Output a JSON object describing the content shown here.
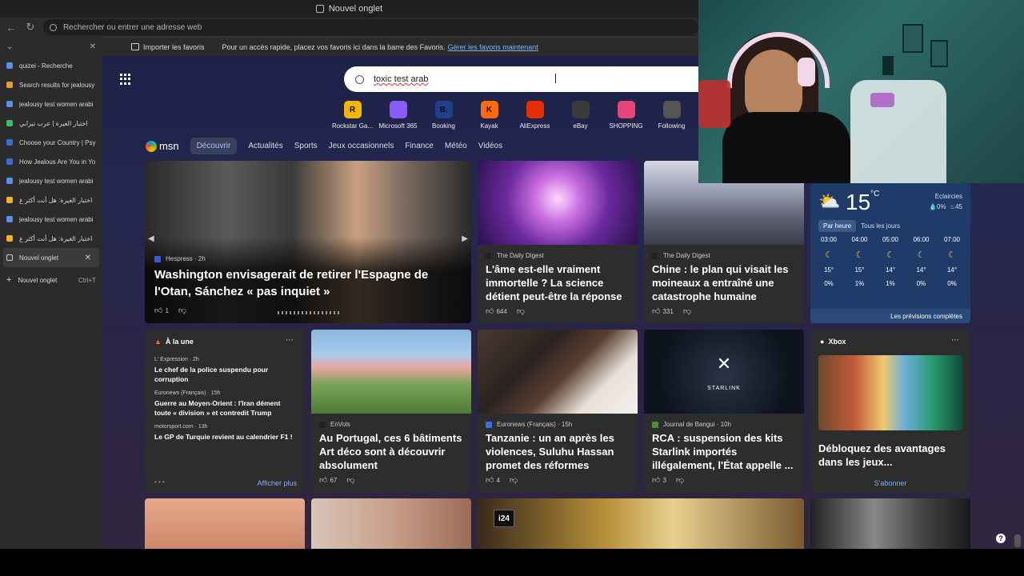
{
  "window": {
    "tab_title": "Nouvel onglet"
  },
  "address_bar": {
    "placeholder": "Rechercher ou entrer une adresse web"
  },
  "favorites_bar": {
    "import_label": "Importer les favoris",
    "message": "Pour un accès rapide, placez vos favoris ici dans la barre des Favoris.",
    "manage_link": "Gérer les favoris maintenant"
  },
  "sidebar": {
    "tabs": [
      {
        "label": "quizei - Recherche",
        "color": "#5a8dee"
      },
      {
        "label": "Search results for jealousy",
        "color": "#e0a030"
      },
      {
        "label": "jealousy test women arabi",
        "color": "#5a8dee"
      },
      {
        "label": "اختبار الغيرة | عرب تيرابي",
        "color": "#36c06a",
        "rtl": true
      },
      {
        "label": "Choose your Country | Psy",
        "color": "#3b6fd6"
      },
      {
        "label": "How Jealous Are You in Yo",
        "color": "#3b6fd6"
      },
      {
        "label": "jealousy test women arabi",
        "color": "#5a8dee"
      },
      {
        "label": "اختبار الغيرة: هل أنت أكثر غ",
        "color": "#f0b429",
        "rtl": true
      },
      {
        "label": "jealousy test women arabi",
        "color": "#5a8dee"
      },
      {
        "label": "اختبار الغيرة: هل أنت أكثر غ",
        "color": "#f0b429",
        "rtl": true
      }
    ],
    "active_tab": "Nouvel onglet",
    "new_tab": "Nouvel onglet",
    "new_tab_shortcut": "Ctrl+T"
  },
  "search": {
    "value": "toxic test arab"
  },
  "quick_links": [
    {
      "label": "Rockstar Ga...",
      "icon": "R",
      "color": "#f2b705"
    },
    {
      "label": "Microsoft 365",
      "icon": "",
      "color": "#8a5cf6"
    },
    {
      "label": "Booking",
      "icon": "B.",
      "color": "#1f3f8f"
    },
    {
      "label": "Kayak",
      "icon": "K",
      "color": "#ff690f"
    },
    {
      "label": "AliExpress",
      "icon": "",
      "color": "#e62e04"
    },
    {
      "label": "eBay",
      "icon": "",
      "color": "#3a3a3a"
    },
    {
      "label": "SHOPPING",
      "icon": "",
      "color": "#e8457a"
    },
    {
      "label": "Following",
      "icon": "",
      "color": "#555555"
    }
  ],
  "msn_nav": {
    "logo": "msn",
    "tabs": [
      "Découvrir",
      "Actualités",
      "Sports",
      "Jeux occasionnels",
      "Finance",
      "Météo",
      "Vidéos"
    ]
  },
  "hero": {
    "source": "Hespress",
    "age": "2h",
    "headline": "Washington envisagerait de retirer l'Espagne de l'Otan, Sánchez « pas inquiet »",
    "likes": "1"
  },
  "card_soul": {
    "source": "The Daily Digest",
    "headline": "L'âme est-elle vraiment immortelle ? La science détient peut-être la réponse",
    "likes": "644"
  },
  "card_china": {
    "source": "The Daily Digest",
    "headline": "Chine : le plan qui visait les moineaux a entraîné une catastrophe humaine",
    "likes": "331"
  },
  "weather": {
    "temp": "15",
    "unit": "°C",
    "condition": "Eclaircies",
    "precip": "0%",
    "humidity": "45",
    "toggle_hourly": "Par heure",
    "toggle_daily": "Tous les jours",
    "hours": [
      {
        "time": "03:00",
        "temp": "15°",
        "rain": "0%"
      },
      {
        "time": "04:00",
        "temp": "15°",
        "rain": "1%"
      },
      {
        "time": "05:00",
        "temp": "14°",
        "rain": "1%"
      },
      {
        "time": "06:00",
        "temp": "14°",
        "rain": "0%"
      },
      {
        "time": "07:00",
        "temp": "14°",
        "rain": "0%"
      }
    ],
    "full_forecast": "Les prévisions complètes"
  },
  "headlines_card": {
    "title": "À la une",
    "items": [
      {
        "source": "L' Expression · 2h",
        "text": "Le chef de la police suspendu pour corruption"
      },
      {
        "source": "Euronews (Français) · 15h",
        "text": "Guerre au Moyen-Orient : l'Iran dément toute « division » et contredit Trump"
      },
      {
        "source": "motorsport.com · 13h",
        "text": "Le GP de Turquie revient au calendrier F1 !"
      }
    ],
    "more": "Afficher plus"
  },
  "card_portugal": {
    "source": "EnVols",
    "headline": "Au Portugal, ces 6 bâtiments Art déco sont à découvrir absolument",
    "likes": "67"
  },
  "card_tanzania": {
    "source": "Euronews (Français) · 15h",
    "headline": "Tanzanie : un an après les violences, Suluhu Hassan promet des réformes",
    "likes": "4"
  },
  "card_starlink": {
    "source": "Journal de Bangui · 10h",
    "headline": "RCA : suspension des kits Starlink importés illégalement, l'État appelle ...",
    "likes": "3",
    "logo_text": "STARLINK"
  },
  "card_xbox": {
    "title": "Xbox",
    "headline": "Débloquez des avantages dans les jeux...",
    "cta": "S'abonner"
  },
  "bottom_row": {
    "i24_label": "i24"
  }
}
